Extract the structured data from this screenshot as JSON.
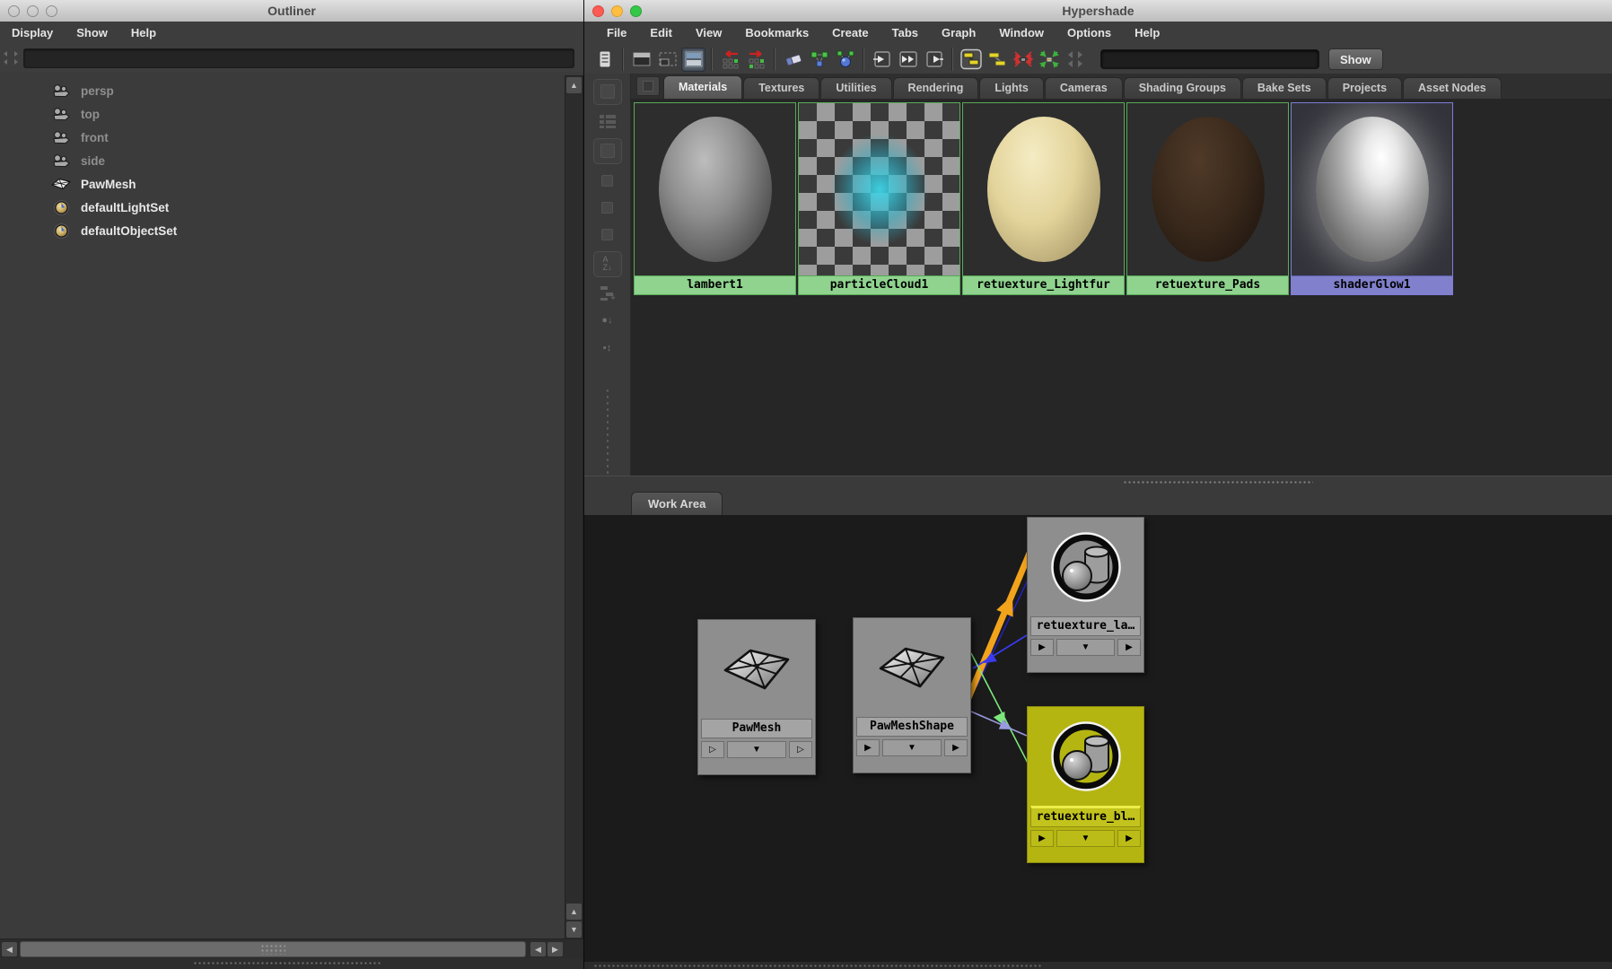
{
  "outliner": {
    "title": "Outliner",
    "menus": [
      "Display",
      "Show",
      "Help"
    ],
    "search": {
      "value": "",
      "placeholder": ""
    },
    "items": [
      {
        "label": "persp",
        "icon": "camera-icon",
        "dimmed": true
      },
      {
        "label": "top",
        "icon": "camera-icon",
        "dimmed": true
      },
      {
        "label": "front",
        "icon": "camera-icon",
        "dimmed": true
      },
      {
        "label": "side",
        "icon": "camera-icon",
        "dimmed": true
      },
      {
        "label": "PawMesh",
        "icon": "mesh-icon",
        "dimmed": false
      },
      {
        "label": "defaultLightSet",
        "icon": "set-icon",
        "dimmed": false
      },
      {
        "label": "defaultObjectSet",
        "icon": "set-icon",
        "dimmed": false
      }
    ]
  },
  "hypershade": {
    "title": "Hypershade",
    "menus": [
      "File",
      "Edit",
      "View",
      "Bookmarks",
      "Create",
      "Tabs",
      "Graph",
      "Window",
      "Options",
      "Help"
    ],
    "toolbar": {
      "search_value": "",
      "show_label": "Show",
      "icons": [
        "create-bar-toggle",
        "layout-single-pane",
        "layout-two-pane",
        "layout-split-pane",
        "navigate-back",
        "navigate-forward",
        "clear-graph",
        "rearrange-graph",
        "graph-add-selected",
        "show-input-connections",
        "show-input-output-connections",
        "show-output-connections",
        "graph-materials-on-selected",
        "show-connected-nodes",
        "collapse-graph",
        "expand-graph",
        "pin-graph"
      ]
    },
    "tabs": [
      {
        "label": "Materials",
        "active": true
      },
      {
        "label": "Textures",
        "active": false
      },
      {
        "label": "Utilities",
        "active": false
      },
      {
        "label": "Rendering",
        "active": false
      },
      {
        "label": "Lights",
        "active": false
      },
      {
        "label": "Cameras",
        "active": false
      },
      {
        "label": "Shading Groups",
        "active": false
      },
      {
        "label": "Bake Sets",
        "active": false
      },
      {
        "label": "Projects",
        "active": false
      },
      {
        "label": "Asset Nodes",
        "active": false
      }
    ],
    "swatches": [
      {
        "name": "lambert1",
        "type": "gray-sphere",
        "label_color": "#8fd38f",
        "selected": false
      },
      {
        "name": "particleCloud1",
        "type": "particle-cloud",
        "label_color": "#8fd38f",
        "selected": false
      },
      {
        "name": "retuexture_Lightfur",
        "type": "cream-sphere",
        "label_color": "#8fd38f",
        "selected": false
      },
      {
        "name": "retuexture_Pads",
        "type": "brown-sphere",
        "label_color": "#8fd38f",
        "selected": false
      },
      {
        "name": "shaderGlow1",
        "type": "glow-sphere",
        "label_color": "#8080cc",
        "selected": true
      }
    ],
    "work_area": {
      "tab_label": "Work Area",
      "nodes": [
        {
          "name": "PawMesh",
          "icon": "mesh-icon",
          "color": "gray",
          "arrows": "hollow"
        },
        {
          "name": "PawMeshShape",
          "icon": "mesh-icon",
          "color": "gray",
          "arrows": "filled"
        },
        {
          "name": "retuexture_la…",
          "icon": "shading-group-icon",
          "color": "gray",
          "arrows": "filled"
        },
        {
          "name": "retuexture_bl…",
          "icon": "shading-group-icon",
          "color": "yellow",
          "arrows": "filled"
        }
      ],
      "connections": [
        {
          "from": "PawMeshShape",
          "to": "retuexture_la…",
          "color": "#f2a31c",
          "style": "thick-arrow"
        },
        {
          "from": "retuexture_la…",
          "to": "PawMeshShape",
          "color": "#3a3aee",
          "style": "thin-arrow"
        },
        {
          "from": "retuexture_la…",
          "to": "PawMeshShape",
          "color": "#2222bb",
          "style": "thin"
        },
        {
          "from": "PawMeshShape",
          "to": "retuexture_bl…",
          "color": "#7ce87c",
          "style": "thin-arrow"
        },
        {
          "from": "PawMeshShape",
          "to": "retuexture_bl…",
          "color": "#9a9ae0",
          "style": "thin-arrow"
        }
      ]
    }
  },
  "colors": {
    "swatch_border_green": "#59ab59",
    "swatch_border_blue": "#7d7dd8",
    "node_gray": "#8e8e8e",
    "node_selected_yellow": "#b5b512",
    "panel_dark": "#262626",
    "workarea_dark": "#1b1b1b",
    "chrome_dark": "#3d3d3d"
  }
}
